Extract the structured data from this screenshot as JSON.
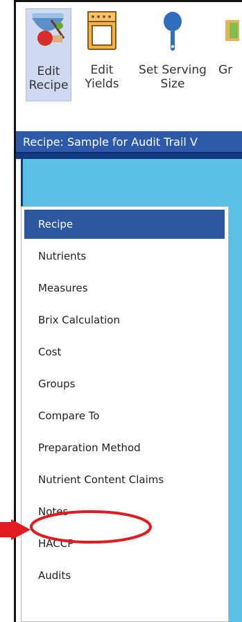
{
  "ribbon": {
    "buttons": [
      {
        "label": "Edit\nRecipe",
        "icon": "edit-recipe-icon",
        "selected": true
      },
      {
        "label": "Edit\nYields",
        "icon": "oven-icon",
        "selected": false
      },
      {
        "label": "Set Serving\nSize",
        "icon": "spoon-icon",
        "selected": false
      },
      {
        "label": "Gr",
        "icon": "groups-icon",
        "selected": false
      }
    ]
  },
  "window": {
    "title": "Recipe: Sample for Audit Trail V"
  },
  "nav": {
    "items": [
      {
        "label": "Recipe",
        "active": true
      },
      {
        "label": "Nutrients"
      },
      {
        "label": "Measures"
      },
      {
        "label": "Brix Calculation"
      },
      {
        "label": "Cost"
      },
      {
        "label": "Groups"
      },
      {
        "label": "Compare To"
      },
      {
        "label": "Preparation Method"
      },
      {
        "label": "Nutrient Content Claims"
      },
      {
        "label": "Notes"
      },
      {
        "label": "HACCP"
      },
      {
        "label": "Audits",
        "highlighted": true
      }
    ]
  },
  "colors": {
    "accent": "#2d5aa8",
    "panel": "#5cc0e6",
    "annotation": "#e11b22"
  }
}
